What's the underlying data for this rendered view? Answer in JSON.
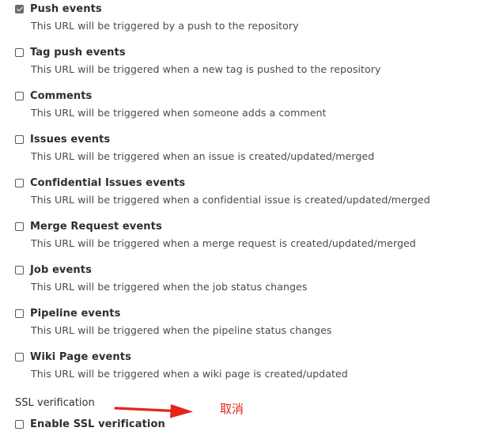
{
  "triggers": [
    {
      "label": "Push events",
      "description": "This URL will be triggered by a push to the repository",
      "checked": true
    },
    {
      "label": "Tag push events",
      "description": "This URL will be triggered when a new tag is pushed to the repository",
      "checked": false
    },
    {
      "label": "Comments",
      "description": "This URL will be triggered when someone adds a comment",
      "checked": false
    },
    {
      "label": "Issues events",
      "description": "This URL will be triggered when an issue is created/updated/merged",
      "checked": false
    },
    {
      "label": "Confidential Issues events",
      "description": "This URL will be triggered when a confidential issue is created/updated/merged",
      "checked": false
    },
    {
      "label": "Merge Request events",
      "description": "This URL will be triggered when a merge request is created/updated/merged",
      "checked": false
    },
    {
      "label": "Job events",
      "description": "This URL will be triggered when the job status changes",
      "checked": false
    },
    {
      "label": "Pipeline events",
      "description": "This URL will be triggered when the pipeline status changes",
      "checked": false
    },
    {
      "label": "Wiki Page events",
      "description": "This URL will be triggered when a wiki page is created/updated",
      "checked": false
    }
  ],
  "ssl": {
    "section_label": "SSL verification",
    "checkbox_label": "Enable SSL verification",
    "checked": false
  },
  "annotation": {
    "text": "取消",
    "color": "#e8231a"
  }
}
